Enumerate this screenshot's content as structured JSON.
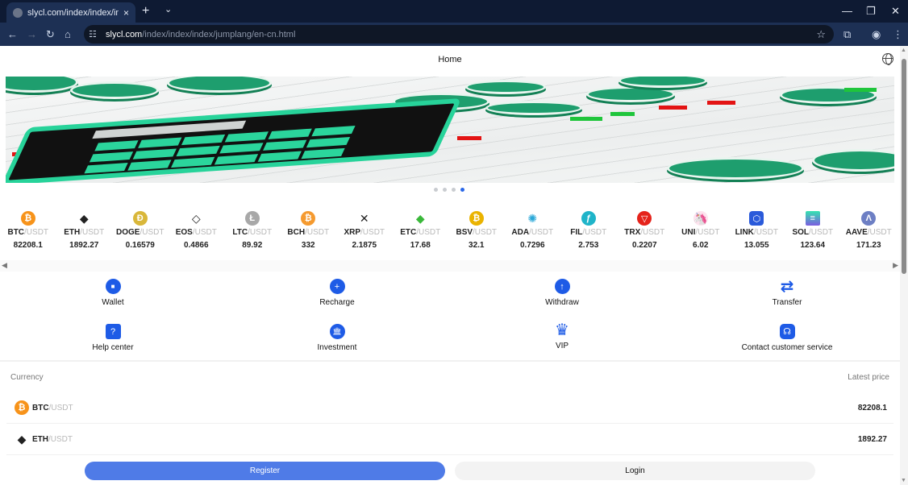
{
  "browser": {
    "tab_title": "slycl.com/index/index/index/ju",
    "url_host": "slycl.com",
    "url_path": "/index/index/index/jumplang/en-cn.html",
    "new_tab": "+",
    "tab_close": "×",
    "tab_dropdown": "⌄",
    "minimize": "—",
    "restore": "❐",
    "close": "✕",
    "back": "←",
    "forward": "→",
    "reload": "↻",
    "home": "⌂",
    "site_info": "☷",
    "bookmark": "☆",
    "extensions": "⧉",
    "profile": "◉",
    "more": "⋮"
  },
  "header": {
    "title": "Home",
    "language_icon": "globe-icon"
  },
  "banner": {
    "slide_count": 4,
    "active_slide": 4
  },
  "ticker": [
    {
      "base": "BTC",
      "quote": "/USDT",
      "price": "82208.1",
      "icon": "bitcoin-icon",
      "glyph": "₿",
      "color": "#f7931a"
    },
    {
      "base": "ETH",
      "quote": "/USDT",
      "price": "1892.27",
      "icon": "ethereum-icon",
      "glyph": "◆",
      "color": "#ffffff"
    },
    {
      "base": "DOGE",
      "quote": "/USDT",
      "price": "0.16579",
      "icon": "dogecoin-icon",
      "glyph": "Ð",
      "color": "#d9b73a"
    },
    {
      "base": "EOS",
      "quote": "/USDT",
      "price": "0.4866",
      "icon": "eos-icon",
      "glyph": "◇",
      "color": "#ffffff"
    },
    {
      "base": "LTC",
      "quote": "/USDT",
      "price": "89.92",
      "icon": "litecoin-icon",
      "glyph": "Ł",
      "color": "#a8a8a8"
    },
    {
      "base": "BCH",
      "quote": "/USDT",
      "price": "332",
      "icon": "bitcoin-cash-icon",
      "glyph": "₿",
      "color": "#f59a2f"
    },
    {
      "base": "XRP",
      "quote": "/USDT",
      "price": "2.1875",
      "icon": "xrp-icon",
      "glyph": "✕",
      "color": "#ffffff"
    },
    {
      "base": "ETC",
      "quote": "/USDT",
      "price": "17.68",
      "icon": "ethereum-classic-icon",
      "glyph": "◆",
      "color": "#ffffff"
    },
    {
      "base": "BSV",
      "quote": "/USDT",
      "price": "32.1",
      "icon": "bitcoin-sv-icon",
      "glyph": "₿",
      "color": "#eab300"
    },
    {
      "base": "ADA",
      "quote": "/USDT",
      "price": "0.7296",
      "icon": "cardano-icon",
      "glyph": "✺",
      "color": "#ffffff"
    },
    {
      "base": "FIL",
      "quote": "/USDT",
      "price": "2.753",
      "icon": "filecoin-icon",
      "glyph": "ƒ",
      "color": "#1fb4c9"
    },
    {
      "base": "TRX",
      "quote": "/USDT",
      "price": "0.2207",
      "icon": "tron-icon",
      "glyph": "▽",
      "color": "#e5231b"
    },
    {
      "base": "UNI",
      "quote": "/USDT",
      "price": "6.02",
      "icon": "uniswap-icon",
      "glyph": "🦄",
      "color": "#fde3ee"
    },
    {
      "base": "LINK",
      "quote": "/USDT",
      "price": "13.055",
      "icon": "chainlink-icon",
      "glyph": "⬡",
      "color": "#2a5ada"
    },
    {
      "base": "SOL",
      "quote": "/USDT",
      "price": "123.64",
      "icon": "solana-icon",
      "glyph": "≡",
      "color": "#7b5ce0"
    },
    {
      "base": "AAVE",
      "quote": "/USDT",
      "price": "171.23",
      "icon": "aave-icon",
      "glyph": "Λ",
      "color": "#6d7fc4"
    }
  ],
  "ticker_scroll": {
    "left": "◀",
    "right": "▶"
  },
  "menu": [
    {
      "label": "Wallet",
      "icon": "wallet-icon",
      "glyph": "■"
    },
    {
      "label": "Recharge",
      "icon": "plus-icon",
      "glyph": "+"
    },
    {
      "label": "Withdraw",
      "icon": "arrow-up-icon",
      "glyph": "↑"
    },
    {
      "label": "Transfer",
      "icon": "transfer-icon",
      "glyph": "⇄"
    },
    {
      "label": "Help center",
      "icon": "help-document-icon",
      "glyph": "?"
    },
    {
      "label": "Investment",
      "icon": "bank-icon",
      "glyph": "🏛"
    },
    {
      "label": "VIP",
      "icon": "crown-icon",
      "glyph": "♛"
    },
    {
      "label": "Contact customer service",
      "icon": "headset-icon",
      "glyph": "☊"
    }
  ],
  "market": {
    "col_currency": "Currency",
    "col_price": "Latest price",
    "rows": [
      {
        "base": "BTC",
        "quote": "/USDT",
        "price": "82208.1",
        "glyph": "₿",
        "color": "#f7931a"
      },
      {
        "base": "ETH",
        "quote": "/USDT",
        "price": "1892.27",
        "glyph": "◆",
        "color": "#ffffff"
      }
    ]
  },
  "actions": {
    "register": "Register",
    "login": "Login"
  },
  "colors": {
    "accent": "#1e5be6",
    "register_bg": "#4f7be7",
    "active_dot": "#2a67e8"
  }
}
